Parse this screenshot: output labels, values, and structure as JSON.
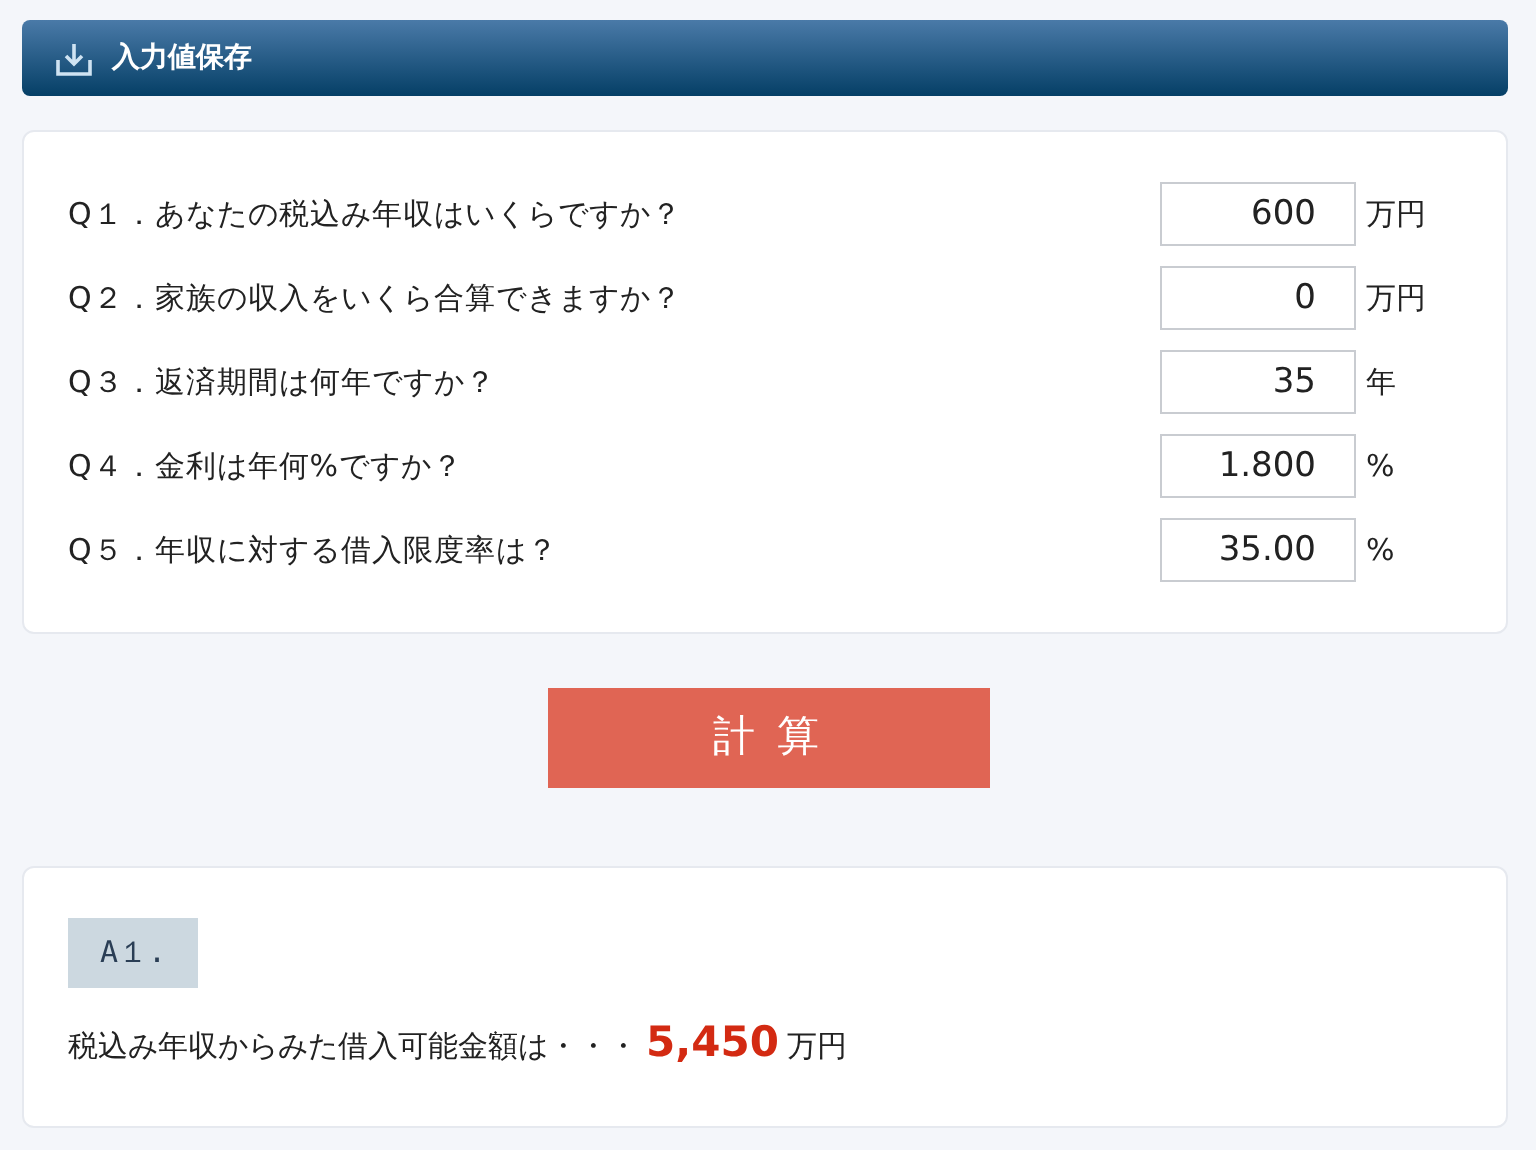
{
  "header": {
    "title": "入力値保存"
  },
  "questions": [
    {
      "label": "Q１．あなたの税込み年収はいくらですか？",
      "value": "600",
      "unit": "万円"
    },
    {
      "label": "Q２．家族の収入をいくら合算できますか？",
      "value": "0",
      "unit": "万円"
    },
    {
      "label": "Q３．返済期間は何年ですか？",
      "value": "35",
      "unit": "年"
    },
    {
      "label": "Q４．金利は年何%ですか？",
      "value": "1.800",
      "unit": "%"
    },
    {
      "label": "Q５．年収に対する借入限度率は？",
      "value": "35.00",
      "unit": "%"
    }
  ],
  "button": "計 算",
  "answer": {
    "tag": "A１.",
    "text": "税込み年収からみた借入可能金額は・・・",
    "amount": "5,450",
    "unit": "万円"
  }
}
